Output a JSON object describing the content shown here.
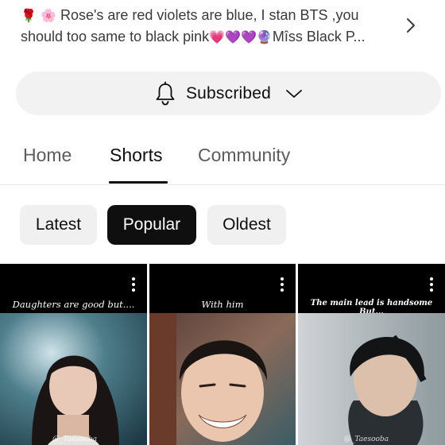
{
  "description": {
    "line1_emoji": "🌹 🌸",
    "line1_text": " Rose's are red violets are blue, I stan BTS ,you",
    "line2_text": "should too same to black pink",
    "line2_emoji": "💗💜💜🔮",
    "line2_tail": "Mîss Black P..."
  },
  "subscribe": {
    "label": "Subscribed"
  },
  "tabs": [
    {
      "label": "Home"
    },
    {
      "label": "Shorts"
    },
    {
      "label": "Community"
    }
  ],
  "active_tab": "Shorts",
  "chips": [
    {
      "label": "Latest"
    },
    {
      "label": "Popular"
    },
    {
      "label": "Oldest"
    }
  ],
  "selected_chip": "Popular",
  "shorts": [
    {
      "caption": "Daughters are good but....",
      "watermark": "@_Taesooba"
    },
    {
      "caption": "With him",
      "watermark": ""
    },
    {
      "caption": "The main lead is handsome But...",
      "watermark": "@_Taesooba"
    }
  ],
  "colors": {
    "active_text": "#0f0f0f",
    "inactive_text": "#5c5c5c",
    "chip_bg": "#f0f0f0",
    "chip_selected_bg": "#0f0f0f",
    "pill_bg": "#f2f2f2"
  },
  "icons": {
    "bell": "notifications-bell-icon",
    "chevron": "chevron-down-icon",
    "more": "chevron-right-icon",
    "menu": "more-vert-icon"
  }
}
